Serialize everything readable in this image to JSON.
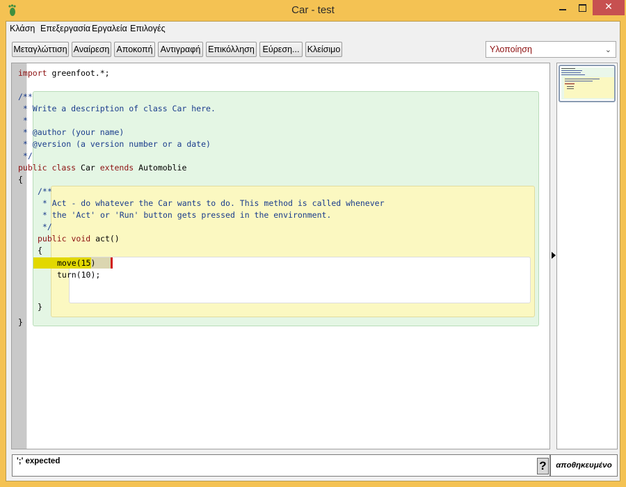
{
  "window": {
    "title": "Car - test",
    "close_glyph": "✕"
  },
  "menubar": {
    "items": [
      "Κλάση",
      "Επεξεργασία",
      "Εργαλεία",
      "Επιλογές"
    ]
  },
  "toolbar": {
    "buttons": [
      "Μεταγλώττιση",
      "Αναίρεση",
      "Αποκοπή",
      "Αντιγραφή",
      "Επικόλληση",
      "Εύρεση...",
      "Κλείσιμο"
    ],
    "view_selected": "Υλοποίηση"
  },
  "editor": {
    "lines": [
      {
        "tokens": [
          {
            "t": "import",
            "c": "kw"
          },
          {
            "t": " greenfoot.*;"
          }
        ]
      },
      {
        "tokens": [
          {
            "t": "/**",
            "c": "cm"
          }
        ]
      },
      {
        "tokens": [
          {
            "t": " * Write a description of class Car here.",
            "c": "cm"
          }
        ]
      },
      {
        "tokens": [
          {
            "t": " *",
            "c": "cm"
          }
        ]
      },
      {
        "tokens": [
          {
            "t": " * @author (your name)",
            "c": "cm"
          }
        ]
      },
      {
        "tokens": [
          {
            "t": " * @version (a version number or a date)",
            "c": "cm"
          }
        ]
      },
      {
        "tokens": [
          {
            "t": " */",
            "c": "cm"
          }
        ]
      },
      {
        "tokens": [
          {
            "t": "public",
            "c": "kw"
          },
          {
            "t": " "
          },
          {
            "t": "class",
            "c": "kw"
          },
          {
            "t": " Car "
          },
          {
            "t": "extends",
            "c": "kw"
          },
          {
            "t": " Automoblie"
          }
        ]
      },
      {
        "tokens": [
          {
            "t": "{"
          }
        ]
      },
      {
        "tokens": [
          {
            "t": "/**",
            "c": "cm"
          }
        ]
      },
      {
        "tokens": [
          {
            "t": " * Act - do whatever the Car wants to do. This method is called whenever",
            "c": "cm"
          }
        ]
      },
      {
        "tokens": [
          {
            "t": " * the 'Act' or 'Run' button gets pressed in the environment.",
            "c": "cm"
          }
        ]
      },
      {
        "tokens": [
          {
            "t": " */",
            "c": "cm"
          }
        ]
      },
      {
        "tokens": [
          {
            "t": "public",
            "c": "kw"
          },
          {
            "t": " "
          },
          {
            "t": "void",
            "c": "kw"
          },
          {
            "t": " act()"
          }
        ]
      },
      {
        "tokens": [
          {
            "t": "{"
          }
        ]
      },
      {
        "tokens": [
          {
            "t": "move(15)"
          }
        ]
      },
      {
        "tokens": [
          {
            "t": "turn(10);"
          }
        ]
      },
      {
        "tokens": [
          {
            "t": "}"
          }
        ]
      },
      {
        "tokens": [
          {
            "t": "}"
          }
        ]
      }
    ]
  },
  "status": {
    "message": "';' expected",
    "help": "?",
    "save_state": "αποθηκευμένο"
  },
  "colors": {
    "titlebar": "#f4c253",
    "keyword": "#8c1010",
    "comment": "#1a3c8c",
    "class_scope": "#e4f6e4",
    "method_scope": "#fbf8c1",
    "error_highlight": "#e2d800",
    "error_caret": "#d11b1b"
  }
}
